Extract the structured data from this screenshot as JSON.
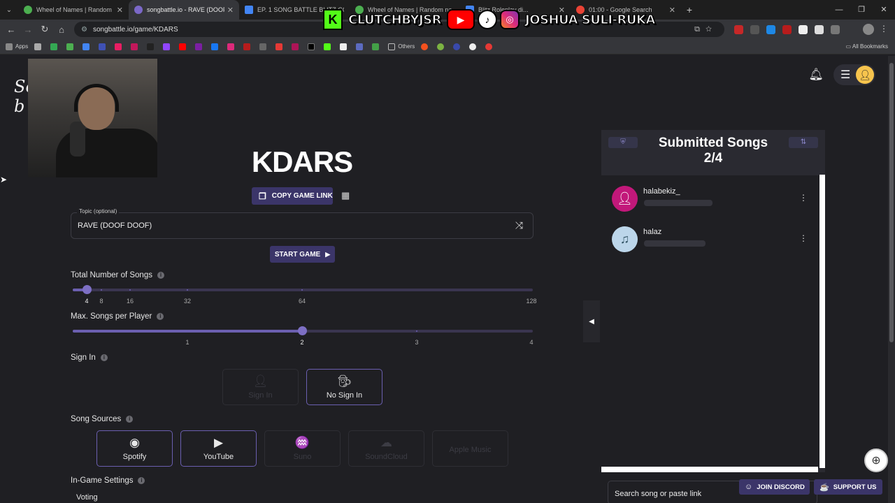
{
  "browser": {
    "tabs": [
      {
        "title": "Wheel of Names | Random name",
        "color": "#4caf50"
      },
      {
        "title": "songbattle.io - RAVE (DOOF DC",
        "color": "#7b68c8",
        "active": true
      },
      {
        "title": "EP. 1 SONG BATTLE BLITZ CO",
        "color": "#4285f4"
      },
      {
        "title": "Wheel of Names | Random na",
        "color": "#4caf50"
      },
      {
        "title": "Blitz Roleplay di...",
        "color": "#4285f4"
      },
      {
        "title": "01:00 - Google Search",
        "color": "#ea4335"
      }
    ],
    "url": "songbattle.io/game/KDARS",
    "bookmarks_apps": "Apps",
    "bookmarks_others": "Others",
    "bookmarks_all": "All Bookmarks"
  },
  "overlay": {
    "kick_name": "CLUTCHBYJSR",
    "social_name": "JOSHUA SULI-RUKA"
  },
  "game": {
    "code": "KDARS",
    "copy_link": "COPY GAME LINK",
    "topic_label": "Topic (optional)",
    "topic_value": "RAVE (DOOF DOOF)",
    "start": "START GAME",
    "total_songs_label": "Total Number of Songs",
    "total_songs_ticks": [
      "4",
      "8",
      "16",
      "32",
      "64",
      "128"
    ],
    "total_songs_value": 4,
    "max_per_player_label": "Max. Songs per Player",
    "max_per_player_ticks": [
      "1",
      "2",
      "3",
      "4"
    ],
    "max_per_player_value": 2,
    "sign_in_label": "Sign In",
    "sign_in_options": [
      "Sign In",
      "No Sign In"
    ],
    "sign_in_selected": "No Sign In",
    "sources_label": "Song Sources",
    "sources": [
      "Spotify",
      "YouTube",
      "Suno",
      "SoundCloud",
      "Apple Music"
    ],
    "sources_enabled": [
      "Spotify",
      "YouTube"
    ],
    "ingame_label": "In-Game Settings",
    "voting_label": "Voting"
  },
  "panel": {
    "title": "Submitted Songs",
    "count": "2/4",
    "submissions": [
      {
        "name": "halabekiz_",
        "avatar_color": "#c2187a"
      },
      {
        "name": "halaz",
        "avatar_color": "#bcd6ea"
      }
    ],
    "search_placeholder": "Search song or paste link"
  },
  "footer": {
    "discord": "JOIN DISCORD",
    "support": "SUPPORT US"
  },
  "colors": {
    "accent": "#6b5fb0",
    "button": "#3b3569",
    "background": "#1f1f23"
  }
}
